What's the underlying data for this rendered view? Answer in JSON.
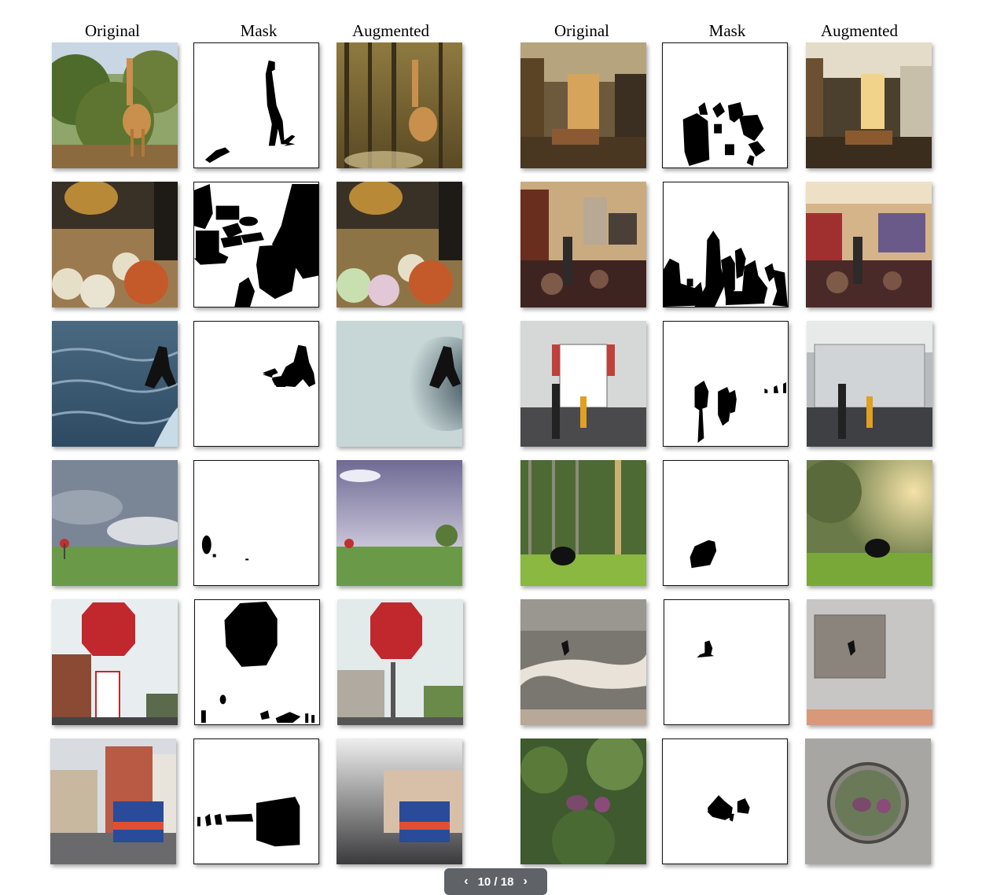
{
  "headers": {
    "left": [
      "Original",
      "Mask",
      "Augmented"
    ],
    "right": [
      "Original",
      "Mask",
      "Augmented"
    ]
  },
  "pager": {
    "prev_icon": "chevron-left-icon",
    "label": "10 / 18",
    "next_icon": "chevron-right-icon"
  }
}
